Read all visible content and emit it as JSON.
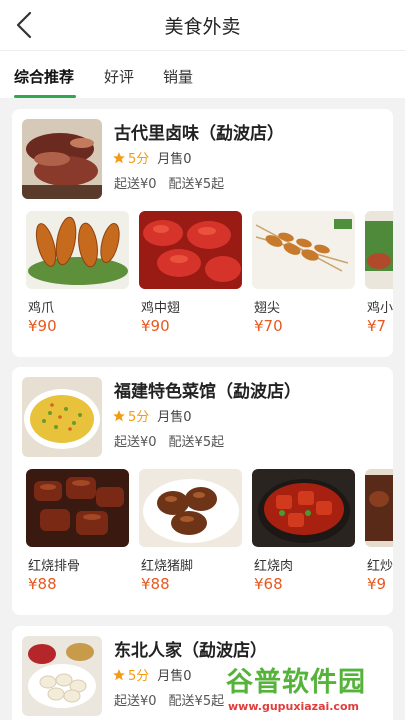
{
  "header": {
    "title": "美食外卖"
  },
  "tabs": [
    {
      "label": "综合推荐",
      "active": true
    },
    {
      "label": "好评",
      "active": false
    },
    {
      "label": "销量",
      "active": false
    }
  ],
  "stores": [
    {
      "name": "古代里卤味（勐波店）",
      "score": "5分",
      "sold": "月售0",
      "min_order": "起送¥0",
      "delivery_fee": "配送¥5起",
      "dishes": [
        {
          "name": "鸡爪",
          "price": "¥90"
        },
        {
          "name": "鸡中翅",
          "price": "¥90"
        },
        {
          "name": "翅尖",
          "price": "¥70"
        },
        {
          "name": "鸡小",
          "price": "¥7"
        }
      ]
    },
    {
      "name": "福建特色菜馆（勐波店）",
      "score": "5分",
      "sold": "月售0",
      "min_order": "起送¥0",
      "delivery_fee": "配送¥5起",
      "dishes": [
        {
          "name": "红烧排骨",
          "price": "¥88"
        },
        {
          "name": "红烧猪脚",
          "price": "¥88"
        },
        {
          "name": "红烧肉",
          "price": "¥68"
        },
        {
          "name": "红炒",
          "price": "¥9"
        }
      ]
    },
    {
      "name": "东北人家（勐波店）",
      "score": "5分",
      "sold": "月售0",
      "min_order": "起送¥0",
      "delivery_fee": "配送¥5起"
    }
  ],
  "watermark": {
    "title": "谷普软件园",
    "url": "www.gupuxiazai.com"
  },
  "colors": {
    "accent": "#2fa84f",
    "price": "#e8591f",
    "star": "#f39c12"
  }
}
